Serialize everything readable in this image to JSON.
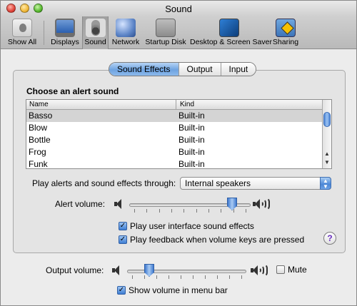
{
  "window": {
    "title": "Sound"
  },
  "toolbar": {
    "items": [
      {
        "label": "Show All",
        "icon": "apple-icon"
      },
      {
        "label": "Displays",
        "icon": "display-icon"
      },
      {
        "label": "Sound",
        "icon": "speaker-icon"
      },
      {
        "label": "Network",
        "icon": "globe-icon"
      },
      {
        "label": "Startup Disk",
        "icon": "disk-icon"
      },
      {
        "label": "Desktop & Screen Saver",
        "icon": "desktop-icon"
      },
      {
        "label": "Sharing",
        "icon": "sharing-icon"
      }
    ],
    "selected": "Sound"
  },
  "tabs": {
    "items": [
      "Sound Effects",
      "Output",
      "Input"
    ],
    "selected": "Sound Effects"
  },
  "alerts": {
    "heading": "Choose an alert sound",
    "columns": {
      "name": "Name",
      "kind": "Kind"
    },
    "rows": [
      {
        "name": "Basso",
        "kind": "Built-in",
        "selected": true
      },
      {
        "name": "Blow",
        "kind": "Built-in"
      },
      {
        "name": "Bottle",
        "kind": "Built-in"
      },
      {
        "name": "Frog",
        "kind": "Built-in"
      },
      {
        "name": "Funk",
        "kind": "Built-in"
      }
    ]
  },
  "play_through": {
    "label": "Play alerts and sound effects through:",
    "value": "Internal speakers"
  },
  "alert_volume": {
    "label": "Alert volume:",
    "level": 0.88
  },
  "checks": {
    "ui_sounds": {
      "label": "Play user interface sound effects",
      "checked": true
    },
    "feedback": {
      "label": "Play feedback when volume keys are pressed",
      "checked": true
    }
  },
  "output_volume": {
    "label": "Output volume:",
    "level": 0.16
  },
  "mute": {
    "label": "Mute",
    "checked": false
  },
  "menu_bar": {
    "label": "Show volume in menu bar",
    "checked": true
  },
  "colors": {
    "accent": "#4a86d6",
    "selection_row": "#d4d4d4"
  }
}
